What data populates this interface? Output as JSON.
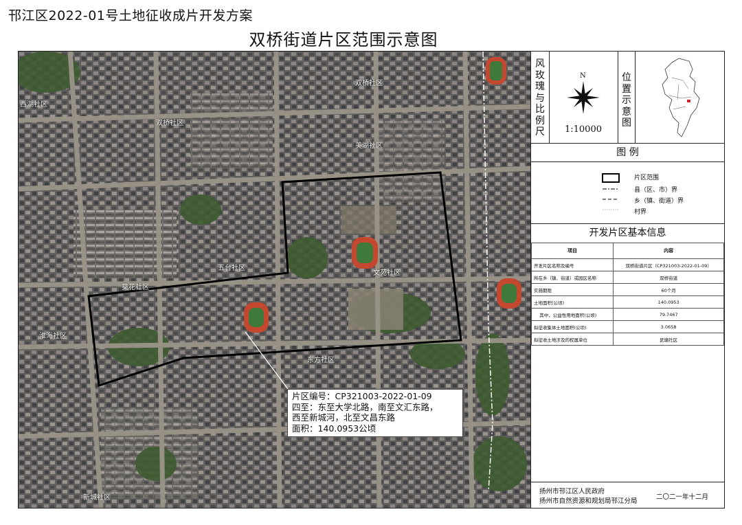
{
  "title": "邗江区2022-01号土地征收成片开发方案",
  "subtitle": "双桥街道片区范围示意图",
  "colors": {
    "aerial_base": "#6b6a68",
    "boundary": "#000000",
    "road": "#9a9488",
    "vegetation": "#3e5b31",
    "track": "#c4472f",
    "field": "#3f7a3a"
  },
  "map_labels": [
    "双桥社区",
    "西湖社区",
    "双桥社区",
    "美湖社区",
    "五台社区",
    "葵花社区",
    "淮海社区",
    "文苑社区",
    "东方社区",
    "新城社区"
  ],
  "callout": {
    "line1": "片区编号：CP321003-2022-01-09",
    "line2": "四至：东至大学北路，南至文汇东路，",
    "line3": "西至新城河，北至文昌东路",
    "line4": "面积：140.0953公顷"
  },
  "side": {
    "compass_label": "风玫瑰与比例尺",
    "north": "N",
    "scale": "1:10000",
    "location_label": "位置示意图",
    "legend_title": "图 例",
    "legend": [
      {
        "label": "片区范围",
        "style": "box"
      },
      {
        "label": "县（区、市）界",
        "style": "dashdot"
      },
      {
        "label": "乡（镇、街道）界",
        "style": "dash"
      },
      {
        "label": "村界",
        "style": "dot"
      }
    ],
    "info_title": "开发片区基本信息",
    "table": {
      "headers": [
        "项目",
        "内容"
      ],
      "rows": [
        {
          "item": "开发片区名称及编号",
          "value": "双桥街道片区（CP321003-2022-01-09）"
        },
        {
          "item": "所在乡（镇、街道）或园区名称",
          "value": "双桥街道"
        },
        {
          "item": "实施期限",
          "value": "60个月"
        },
        {
          "item": "土地面积(公顷)",
          "value": "140.0953"
        },
        {
          "item": "    其中，公益性用地面积(公顷)",
          "value": "79.7467"
        },
        {
          "item": "拟征收集体土地面积(公顷)",
          "value": "3.0658"
        },
        {
          "item": "拟征收土地涉及的权属单位",
          "value": "武塘社区"
        }
      ]
    },
    "footer_org1": "扬州市邗江区人民政府",
    "footer_org2": "扬州市自然资源和规划局邗江分局",
    "footer_date": "二〇二一年十二月"
  }
}
